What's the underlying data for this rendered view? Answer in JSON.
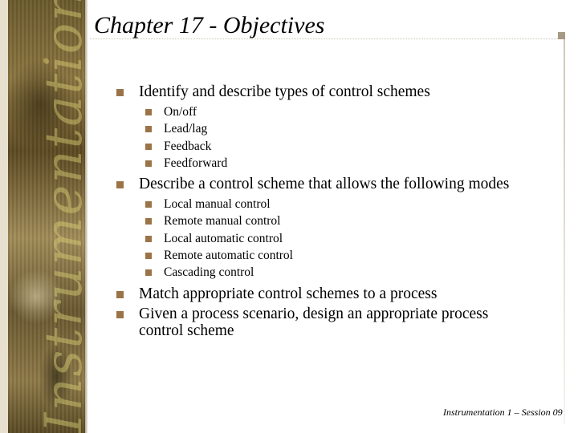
{
  "slide": {
    "title": "Chapter 17 - Objectives",
    "decorative_strip_word": "Instrumentation",
    "objectives": [
      {
        "text": "Identify and describe types of control schemes",
        "sub": [
          "On/off",
          "Lead/lag",
          "Feedback",
          "Feedforward"
        ]
      },
      {
        "text": "Describe a control scheme that allows the following modes",
        "sub": [
          "Local manual control",
          "Remote manual control",
          "Local automatic control",
          "Remote automatic control",
          "Cascading control"
        ]
      },
      {
        "text": "Match appropriate control schemes to a process",
        "sub": []
      },
      {
        "text": "Given a process scenario, design an appropriate process control scheme",
        "sub": []
      }
    ],
    "footer": "Instrumentation 1 – Session 09",
    "colors": {
      "bullet": "#9a7448",
      "accent_square": "#a69a85"
    }
  }
}
